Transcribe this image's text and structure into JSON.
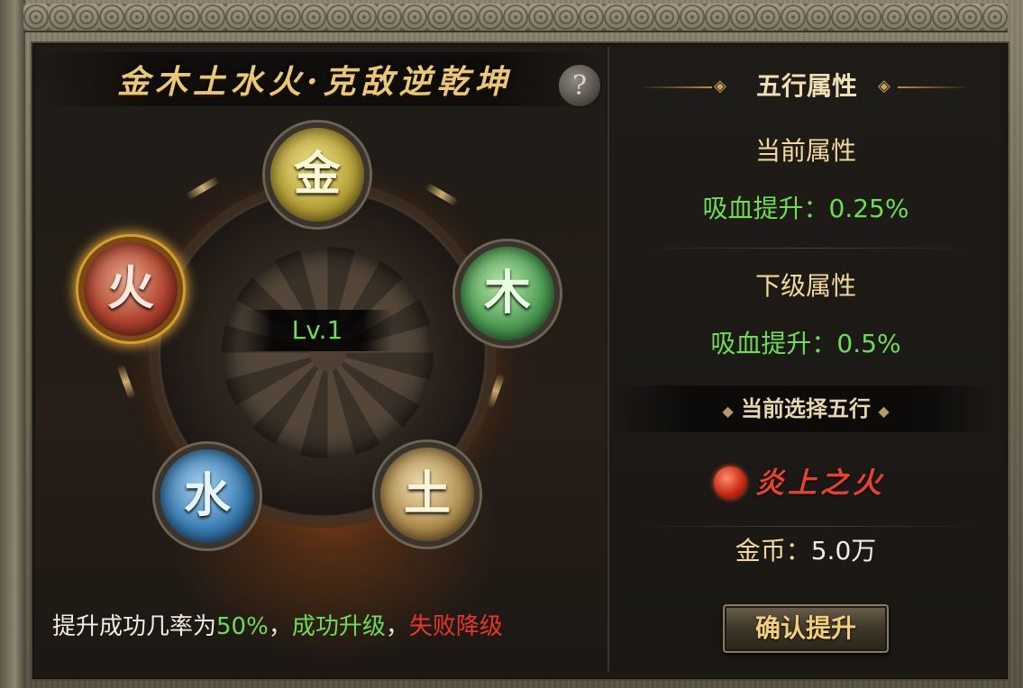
{
  "title": "金木土水火·克敌逆乾坤",
  "help_icon_label": "?",
  "wheel": {
    "level_label": "Lv.1",
    "orbs": {
      "metal": "金",
      "wood": "木",
      "fire": "火",
      "water": "水",
      "earth": "土"
    },
    "selected_orb": "fire"
  },
  "rate_line": {
    "prefix": "提升成功几率为",
    "rate": "50%",
    "comma1": "，",
    "success": "成功升级",
    "comma2": "，",
    "fail": "失败降级"
  },
  "right_panel": {
    "header": "五行属性",
    "current_label": "当前属性",
    "current_value": "吸血提升：0.25%",
    "next_label": "下级属性",
    "next_value": "吸血提升：0.5%",
    "selection_title": "当前选择五行",
    "selected_name": "炎上之火",
    "gold_label": "金币：",
    "gold_value": "5.0万",
    "confirm_button": "确认提升"
  },
  "colors": {
    "accent_gold": "#f2d89a",
    "value_green": "#6fdc55",
    "warn_red": "#e8362a"
  }
}
